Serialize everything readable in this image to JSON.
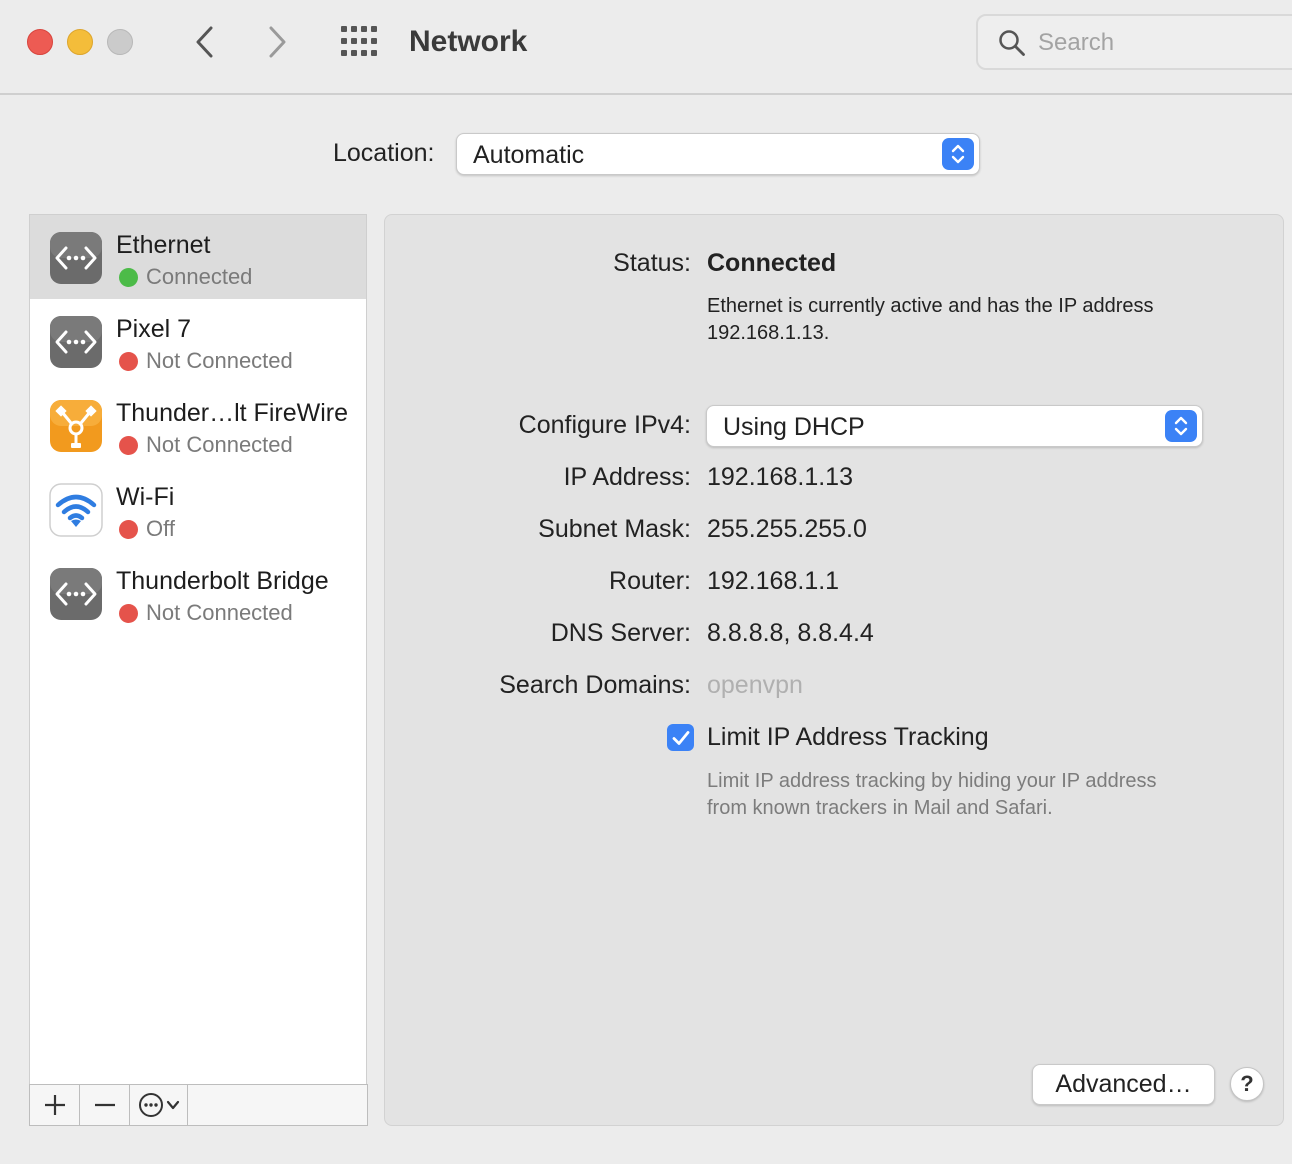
{
  "window": {
    "title": "Network",
    "search_placeholder": "Search"
  },
  "location": {
    "label": "Location:",
    "value": "Automatic"
  },
  "services": [
    {
      "name": "Ethernet",
      "status": "Connected",
      "status_color": "#4cbb48",
      "icon": "ethernet-icon",
      "selected": true
    },
    {
      "name": "Pixel 7",
      "status": "Not Connected",
      "status_color": "#e5534b",
      "icon": "ethernet-icon",
      "selected": false
    },
    {
      "name": "Thunder…lt FireWire",
      "status": "Not Connected",
      "status_color": "#e5534b",
      "icon": "firewire-icon",
      "selected": false
    },
    {
      "name": "Wi-Fi",
      "status": "Off",
      "status_color": "#e5534b",
      "icon": "wifi-icon",
      "selected": false
    },
    {
      "name": "Thunderbolt Bridge",
      "status": "Not Connected",
      "status_color": "#e5534b",
      "icon": "ethernet-icon",
      "selected": false
    }
  ],
  "toolbar": {
    "add": "+",
    "remove": "—"
  },
  "detail": {
    "status_label": "Status:",
    "status_value": "Connected",
    "status_description": "Ethernet is currently active and has the IP address 192.168.1.13.",
    "ipv4_label": "Configure IPv4:",
    "ipv4_value": "Using DHCP",
    "ip_label": "IP Address:",
    "ip_value": "192.168.1.13",
    "subnet_label": "Subnet Mask:",
    "subnet_value": "255.255.255.0",
    "router_label": "Router:",
    "router_value": "192.168.1.1",
    "dns_label": "DNS Server:",
    "dns_value": "8.8.8.8, 8.8.4.4",
    "domains_label": "Search Domains:",
    "domains_value": "openvpn",
    "limit_label": "Limit IP Address Tracking",
    "limit_checked": true,
    "limit_description": "Limit IP address tracking by hiding your IP address from known trackers in Mail and Safari.",
    "advanced_label": "Advanced…",
    "help_label": "?"
  },
  "colors": {
    "accent": "#3b82f6",
    "connected": "#4cbb48",
    "disconnected": "#e5534b"
  }
}
